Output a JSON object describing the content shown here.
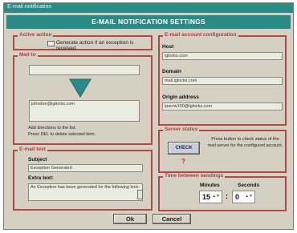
{
  "window": {
    "title": "E-mail notification"
  },
  "header": {
    "title": "E-MAIL NOTIFICATION SETTINGS"
  },
  "active_action": {
    "legend": "Active action",
    "checkbox_label": "Generate action if an exception is received"
  },
  "mail_to": {
    "legend": "Mail to",
    "address_item": "johndoe@iglocks.com",
    "hint_line1": "Add directions to the list.",
    "hint_line2": "Press DEL to delete selected item."
  },
  "email_text": {
    "legend": "E-mail text",
    "subject_label": "Subject",
    "subject_value": "Exception Generated",
    "extra_label": "Extra text:",
    "extra_value": "An Exception has been generated for the following lock:"
  },
  "account": {
    "legend": "E-mail account configuration",
    "host_label": "Host",
    "host_value": "iglocks.com",
    "domain_label": "Domain",
    "domain_value": "mail.iglocks.com",
    "origin_label": "Origin address",
    "origin_value": "ipscrw100@iglocks.com"
  },
  "server_status": {
    "legend": "Server status",
    "check_label": "CHECK",
    "status_value": "?",
    "description": "Press button to check status of the mail server for the configured account."
  },
  "time_between": {
    "legend": "Time between sendings",
    "minutes_label": "Minutes",
    "seconds_label": "Seconds",
    "minutes_value": "15",
    "seconds_value": "0",
    "separator": ":"
  },
  "buttons": {
    "ok": "Ok",
    "cancel": "Cancel"
  },
  "colors": {
    "accent": "#2a8a86",
    "group_border": "#b44848",
    "arrow": "#2a8a8a"
  },
  "icons": [
    "checkbox-icon",
    "down-arrow-icon",
    "spin-arrows-icon"
  ]
}
